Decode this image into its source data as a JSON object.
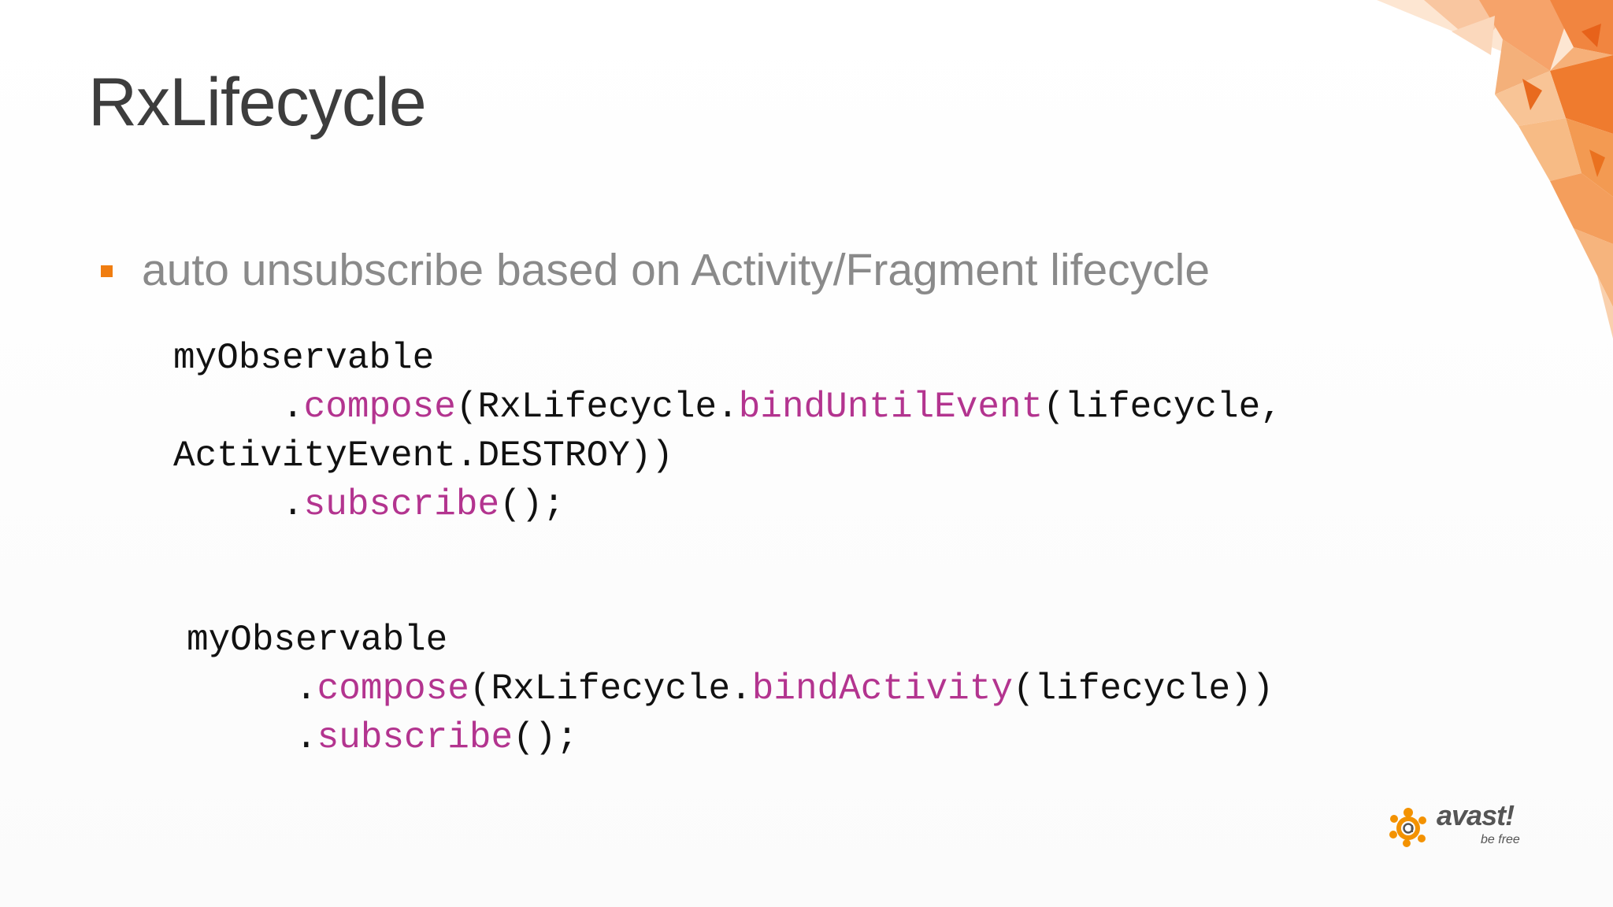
{
  "slide": {
    "title": "RxLifecycle",
    "bullets": [
      "auto unsubscribe based on Activity/Fragment lifecycle"
    ]
  },
  "code_examples": [
    {
      "lines": [
        [
          {
            "text": "myObservable"
          }
        ],
        [
          {
            "text": "     ."
          },
          {
            "text": "compose",
            "kw": true
          },
          {
            "text": "(RxLifecycle."
          },
          {
            "text": "bindUntilEvent",
            "kw": true
          },
          {
            "text": "(lifecycle,"
          }
        ],
        [
          {
            "text": "ActivityEvent.DESTROY))"
          }
        ],
        [
          {
            "text": "     ."
          },
          {
            "text": "subscribe",
            "kw": true
          },
          {
            "text": "();"
          }
        ]
      ]
    },
    {
      "lines": [
        [
          {
            "text": "myObservable"
          }
        ],
        [
          {
            "text": "     ."
          },
          {
            "text": "compose",
            "kw": true
          },
          {
            "text": "(RxLifecycle."
          },
          {
            "text": "bindActivity",
            "kw": true
          },
          {
            "text": "(lifecycle))"
          }
        ],
        [
          {
            "text": "     ."
          },
          {
            "text": "subscribe",
            "kw": true
          },
          {
            "text": "();"
          }
        ]
      ]
    }
  ],
  "logo": {
    "wordmark": "avast!",
    "tagline": "be free"
  },
  "colors": {
    "title": "#3d3d3d",
    "bullet_marker": "#f07d10",
    "bullet_text": "#8a8a8a",
    "code_text": "#111111",
    "code_keyword": "#b3348f",
    "accent_orange": "#f07d10"
  },
  "icons": {
    "bullet": "orange-square-icon",
    "logo": "avast-burst-icon"
  }
}
